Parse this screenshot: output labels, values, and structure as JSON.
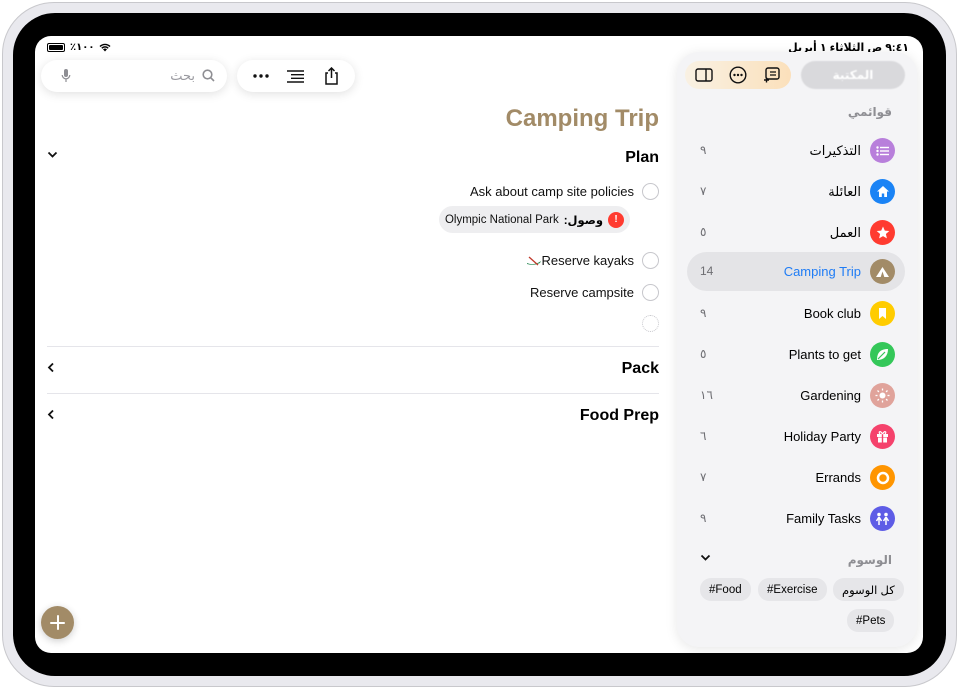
{
  "status_bar": {
    "time_date": "٩:٤١ ص  الثلاثاء ١ أبريل",
    "battery": "٪١٠٠"
  },
  "search": {
    "placeholder": "بحث"
  },
  "toolbar": {
    "more_icon": "ellipsis-icon",
    "list_options_icon": "list-indent-icon",
    "share_icon": "share-icon"
  },
  "main": {
    "title": "Camping Trip",
    "accent_color": "#a28b67",
    "sections": [
      {
        "name": "Plan",
        "expanded": true
      },
      {
        "name": "Pack",
        "expanded": false
      },
      {
        "name": "Food Prep",
        "expanded": false
      }
    ],
    "reminders": [
      {
        "text": "Ask about camp site policies"
      },
      {
        "text": "Reserve kayaks"
      },
      {
        "text": "Reserve campsite"
      }
    ],
    "location_chip": {
      "urgent": "!",
      "label": "وصول:",
      "value": "Olympic National Park"
    }
  },
  "sidebar": {
    "edit_label": "المكتبة",
    "my_lists_heading": "قوائمي",
    "lists": [
      {
        "name": "التذكيرات",
        "count": "٩",
        "color": "#b87fdb",
        "icon": "list-icon"
      },
      {
        "name": "العائلة",
        "count": "٧",
        "color": "#1a83f5",
        "icon": "house-icon"
      },
      {
        "name": "العمل",
        "count": "٥",
        "color": "#ff3b30",
        "icon": "star-icon"
      },
      {
        "name": "Camping Trip",
        "count": "14",
        "color": "#a28b67",
        "icon": "tent-icon",
        "active": true
      },
      {
        "name": "Book club",
        "count": "٩",
        "color": "#ffcc00",
        "icon": "bookmark-icon"
      },
      {
        "name": "Plants to get",
        "count": "٥",
        "color": "#34c759",
        "icon": "leaf-icon"
      },
      {
        "name": "Gardening",
        "count": "١٦",
        "color": "#e0a39b",
        "icon": "sun-icon"
      },
      {
        "name": "Holiday Party",
        "count": "٦",
        "color": "#f5426c",
        "icon": "gift-icon"
      },
      {
        "name": "Errands",
        "count": "٧",
        "color": "#ff9500",
        "icon": "circle-icon"
      },
      {
        "name": "Family Tasks",
        "count": "٩",
        "color": "#5e5ce6",
        "icon": "people-icon"
      }
    ],
    "tags_heading": "الوسوم",
    "tags": [
      "كل الوسوم",
      "#Exercise",
      "#Food",
      "#Pets"
    ]
  }
}
